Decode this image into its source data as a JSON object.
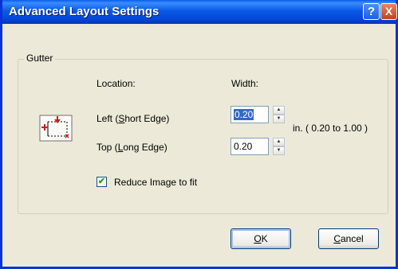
{
  "window": {
    "title": "Advanced Layout Settings",
    "help_icon": "?",
    "close_icon": "X"
  },
  "gutter": {
    "label": "Gutter",
    "location_header": "Location:",
    "width_header": "Width:",
    "left_label_pre": "Left (",
    "left_label_ul": "S",
    "left_label_post": "hort Edge)",
    "left_value": "0.20",
    "top_label_pre": "Top (",
    "top_label_ul": "L",
    "top_label_post": "ong Edge)",
    "top_value": "0.20",
    "range_text": "in. ( 0.20 to 1.00 )",
    "icon": "gutter-layout-icon"
  },
  "reduce_image": {
    "label": "Reduce Image to fit",
    "checked": true
  },
  "buttons": {
    "ok_ul": "O",
    "ok_rest": "K",
    "cancel_ul": "C",
    "cancel_rest": "ancel"
  },
  "colors": {
    "titlebar": "#0a5ae6",
    "close": "#c2411c",
    "dialog_bg": "#ece9d8"
  }
}
